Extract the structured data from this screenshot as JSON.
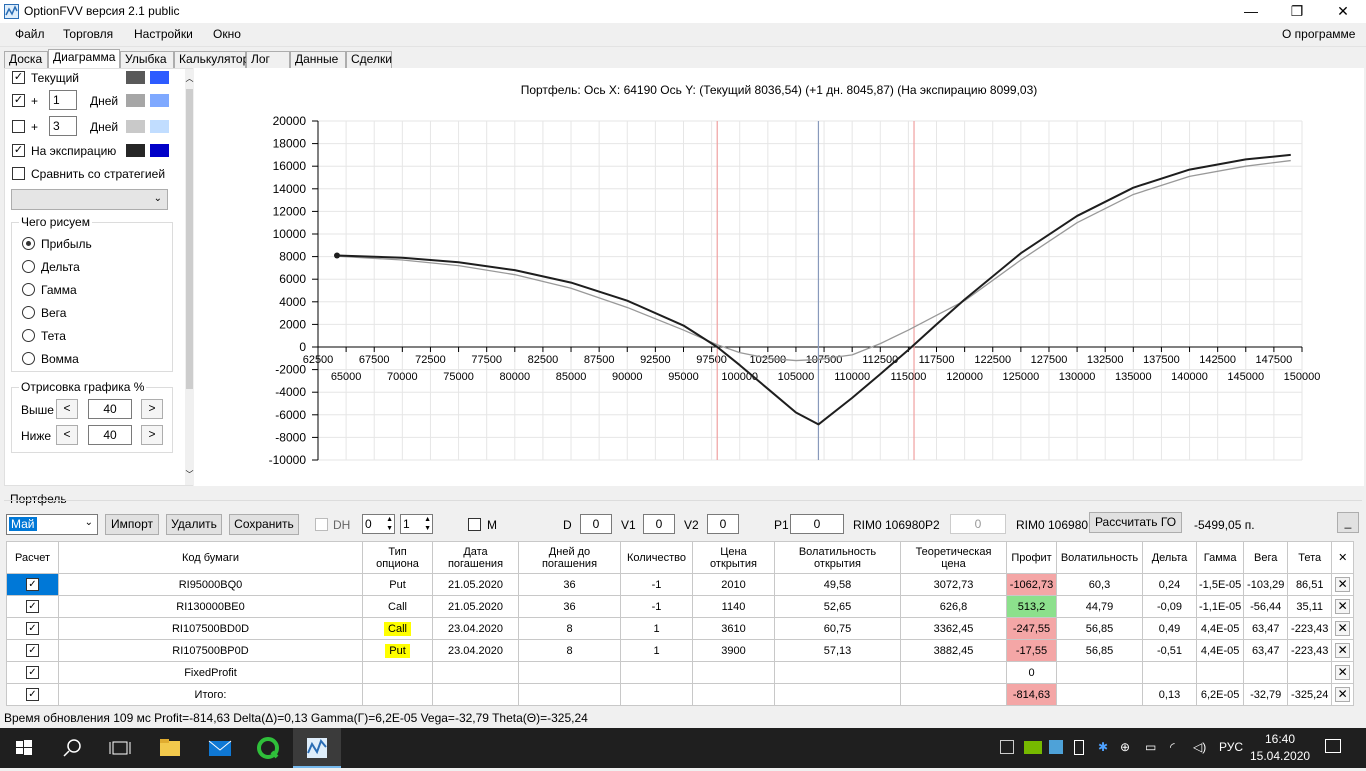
{
  "window": {
    "title": "OptionFVV версия 2.1 public",
    "min": "—",
    "max": "❐",
    "close": "✕"
  },
  "menu": {
    "items": [
      "Файл",
      "Торговля",
      "Настройки",
      "Окно"
    ],
    "about": "О программе"
  },
  "tabs": [
    "Доска",
    "Диаграмма",
    "Улыбка",
    "Калькулятор",
    "Лог",
    "Данные",
    "Сделки"
  ],
  "left": {
    "rows": [
      {
        "checked": true,
        "label": "Текущий",
        "c1": "#595959",
        "c2": "#2d5bff"
      },
      {
        "checked": true,
        "plus": "+",
        "days": "1",
        "days_label": "Дней",
        "c1": "#a6a6a6",
        "c2": "#7fa9ff"
      },
      {
        "checked": false,
        "plus": "+",
        "days": "3",
        "days_label": "Дней",
        "c1": "#c9c9c9",
        "c2": "#c1ddff"
      },
      {
        "checked": true,
        "label": "На экспирацию",
        "c1": "#262626",
        "c2": "#0000c8"
      }
    ],
    "compare_label": "Сравнить со стратегией",
    "draw_group": "Чего рисуем",
    "radios": [
      "Прибыль",
      "Дельта",
      "Гамма",
      "Вега",
      "Тета",
      "Вомма"
    ],
    "render_group": "Отрисовка графика %",
    "above_label": "Выше",
    "above_value": "40",
    "below_label": "Ниже",
    "below_value": "40",
    "left_arrow": "<",
    "right_arrow": ">"
  },
  "chart_data": {
    "type": "line",
    "title": "Портфель: Ось X: 64190 Ось Y:  (Текущий 8036,54)  (+1 дн. 8045,87)  (На экспирацию 8099,03)",
    "xlim": [
      62500,
      150000
    ],
    "ylim": [
      -10000,
      20000
    ],
    "x_ticks_top": [
      "62500",
      "67500",
      "72500",
      "77500",
      "82500",
      "87500",
      "92500",
      "97500",
      "102500",
      "107500",
      "112500",
      "117500",
      "122500",
      "127500",
      "132500",
      "137500",
      "142500",
      "147500"
    ],
    "x_ticks_bottom": [
      "65000",
      "70000",
      "75000",
      "80000",
      "85000",
      "90000",
      "95000",
      "100000",
      "105000",
      "110000",
      "115000",
      "120000",
      "125000",
      "130000",
      "135000",
      "140000",
      "145000",
      "150000"
    ],
    "y_ticks": [
      "20000",
      "18000",
      "16000",
      "14000",
      "12000",
      "10000",
      "8000",
      "6000",
      "4000",
      "2000",
      "0",
      "-2000",
      "-4000",
      "-6000",
      "-8000",
      "-10000"
    ],
    "vlines": [
      {
        "x": 98000,
        "color": "#f0a0a0"
      },
      {
        "x": 107000,
        "color": "#8899bb"
      },
      {
        "x": 115500,
        "color": "#f0a0a0"
      }
    ],
    "series": [
      {
        "color": "#1e1e1e",
        "x": [
          64190,
          70000,
          75000,
          80000,
          85000,
          90000,
          95000,
          98000,
          100000,
          102500,
          105000,
          107000,
          110000,
          112500,
          115000,
          117500,
          120000,
          125000,
          130000,
          135000,
          140000,
          145000,
          149000
        ],
        "y": [
          8099,
          7900,
          7500,
          6800,
          5700,
          4100,
          1900,
          0,
          -1600,
          -3700,
          -5800,
          -6850,
          -4500,
          -2400,
          -250,
          2000,
          4200,
          8300,
          11600,
          14100,
          15700,
          16600,
          17000
        ]
      },
      {
        "color": "#999999",
        "x": [
          64190,
          70000,
          75000,
          80000,
          85000,
          90000,
          95000,
          98000,
          100000,
          102500,
          105000,
          107000,
          110000,
          112500,
          115000,
          117500,
          120000,
          125000,
          130000,
          135000,
          140000,
          145000,
          149000
        ],
        "y": [
          8036,
          7700,
          7200,
          6400,
          5200,
          3500,
          1500,
          200,
          -500,
          -1000,
          -1200,
          -1100,
          -700,
          300,
          1500,
          2800,
          4100,
          7700,
          11000,
          13500,
          15100,
          16000,
          16500
        ]
      }
    ]
  },
  "portfolio": {
    "group": "Портфель",
    "month": "Май",
    "import": "Импорт",
    "delete": "Удалить",
    "save": "Сохранить",
    "dh": "DH",
    "s1": "0",
    "s2": "1",
    "m": "M",
    "d_label": "D",
    "d": "0",
    "v1_label": "V1",
    "v1": "0",
    "v2_label": "V2",
    "v2": "0",
    "p1_label": "P1",
    "p1": "0",
    "p1_code": "RIM0 106980",
    "p2_label": "P2",
    "p2": "0",
    "p2_code": "RIM0 106980",
    "calc_go": "Рассчитать ГО",
    "go_value": "-5499,05 п.",
    "minimize": "_"
  },
  "table": {
    "headers": [
      "Расчет",
      "Код бумаги",
      "Тип\nопциона",
      "Дата\nпогашения",
      "Дней до\nпогашения",
      "Количество",
      "Цена\nоткрытия",
      "Волатильность\nоткрытия",
      "Теоретическая\nцена",
      "Профит",
      "Волатильность",
      "Дельта",
      "Гамма",
      "Вега",
      "Тета",
      "✕"
    ],
    "rows": [
      {
        "code": "RI95000BQ0",
        "type": "Put",
        "date": "21.05.2020",
        "days": "36",
        "qty": "-1",
        "price": "2010",
        "vol_open": "49,58",
        "theo": "3072,73",
        "profit": "-1062,73",
        "vol": "60,3",
        "delta": "0,24",
        "gamma": "-1,5E-05",
        "vega": "-103,29",
        "theta": "86,51",
        "pc": "red",
        "hl": false
      },
      {
        "code": "RI130000BE0",
        "type": "Call",
        "date": "21.05.2020",
        "days": "36",
        "qty": "-1",
        "price": "1140",
        "vol_open": "52,65",
        "theo": "626,8",
        "profit": "513,2",
        "vol": "44,79",
        "delta": "-0,09",
        "gamma": "-1,1E-05",
        "vega": "-56,44",
        "theta": "35,11",
        "pc": "green",
        "hl": false
      },
      {
        "code": "RI107500BD0D",
        "type": "Call",
        "date": "23.04.2020",
        "days": "8",
        "qty": "1",
        "price": "3610",
        "vol_open": "60,75",
        "theo": "3362,45",
        "profit": "-247,55",
        "vol": "56,85",
        "delta": "0,49",
        "gamma": "4,4E-05",
        "vega": "63,47",
        "theta": "-223,43",
        "pc": "red",
        "hl": true
      },
      {
        "code": "RI107500BP0D",
        "type": "Put",
        "date": "23.04.2020",
        "days": "8",
        "qty": "1",
        "price": "3900",
        "vol_open": "57,13",
        "theo": "3882,45",
        "profit": "-17,55",
        "vol": "56,85",
        "delta": "-0,51",
        "gamma": "4,4E-05",
        "vega": "63,47",
        "theta": "-223,43",
        "pc": "red",
        "hl": true
      },
      {
        "code": "FixedProfit",
        "type": "",
        "date": "",
        "days": "",
        "qty": "",
        "price": "",
        "vol_open": "",
        "theo": "",
        "profit": "0",
        "vol": "",
        "delta": "",
        "gamma": "",
        "vega": "",
        "theta": "",
        "pc": "",
        "hl": false
      },
      {
        "code": "Итого:",
        "type": "",
        "date": "",
        "days": "",
        "qty": "",
        "price": "",
        "vol_open": "",
        "theo": "",
        "profit": "-814,63",
        "vol": "",
        "delta": "0,13",
        "gamma": "6,2E-05",
        "vega": "-32,79",
        "theta": "-325,24",
        "pc": "red",
        "hl": false
      }
    ]
  },
  "status": "Время обновления 109 мс  Profit=-814,63 Delta(Δ)=0,13 Gamma(Γ)=6,2E-05 Vega=-32,79 Theta(Θ)=-325,24",
  "taskbar": {
    "lang": "РУС",
    "time": "16:40",
    "date": "15.04.2020"
  }
}
